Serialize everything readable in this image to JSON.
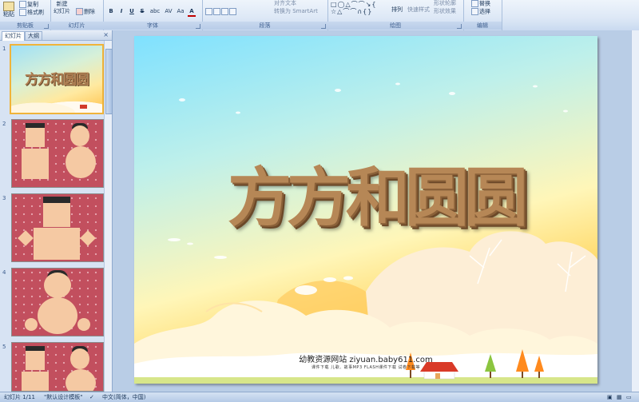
{
  "ribbon": {
    "groups": [
      {
        "label": "剪贴板"
      },
      {
        "label": "幻灯片"
      },
      {
        "label": "字体"
      },
      {
        "label": "段落"
      },
      {
        "label": "绘图"
      },
      {
        "label": "编辑"
      }
    ],
    "clipboard": {
      "paste": "粘贴",
      "copy": "复制",
      "format_painter": "格式刷"
    },
    "slides": {
      "new_slide_line1": "新建",
      "new_slide_line2": "幻灯片",
      "delete": "删除"
    },
    "font": {
      "buttons": [
        "B",
        "I",
        "U",
        "S",
        "abc",
        "AV",
        "Aa",
        "A"
      ]
    },
    "paragraph": {
      "text_direction": "对齐文本",
      "smartart": "转换为 SmartArt"
    },
    "drawing": {
      "arrange": "排列",
      "quick_styles": "快速样式",
      "shape_fill": "形状轮廓",
      "shape_effects": "形状效果"
    },
    "editing": {
      "replace": "替换",
      "select": "选择"
    }
  },
  "pane": {
    "tabs": [
      {
        "label": "幻灯片"
      },
      {
        "label": "大纲"
      }
    ],
    "close": "×",
    "thumbnails": [
      {
        "num": "1",
        "title": "方方和圆圆"
      },
      {
        "num": "2"
      },
      {
        "num": "3"
      },
      {
        "num": "4"
      },
      {
        "num": "5"
      }
    ]
  },
  "slide": {
    "title": "方方和圆圆",
    "credit": "幼教资源网站  ziyuan.baby611.com",
    "subcredit": "课件下载    儿歌、故事MP3    FLASH课件下载    试卷下载等"
  },
  "status": {
    "slide_info": "幻灯片 1/11",
    "theme": "\"默认设计模板\"",
    "language": "中文(简体，中国)"
  },
  "colors": {
    "title_brown": "#b68756",
    "thumb_red": "#c24f5e",
    "skin": "#f5c9a3",
    "selected_border": "#f0b43a"
  }
}
